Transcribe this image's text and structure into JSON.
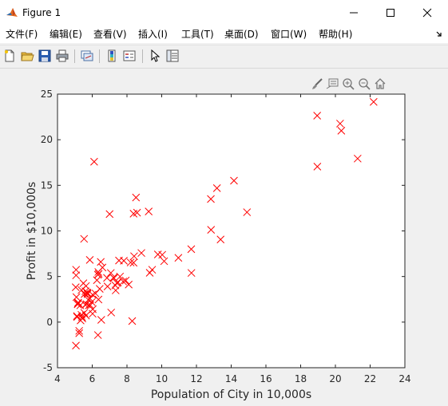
{
  "window": {
    "title": "Figure 1",
    "icon": "matlab-logo-icon"
  },
  "menu": {
    "items": [
      {
        "label": "文件(F)"
      },
      {
        "label": "编辑(E)"
      },
      {
        "label": "查看(V)"
      },
      {
        "label": "插入(I)"
      },
      {
        "label": "工具(T)"
      },
      {
        "label": "桌面(D)"
      },
      {
        "label": "窗口(W)"
      },
      {
        "label": "帮助(H)"
      }
    ],
    "overflow_icon": "chevron-corner-icon"
  },
  "toolbar": {
    "buttons": [
      "new-figure-icon",
      "open-file-icon",
      "save-icon",
      "print-icon",
      "link-plot-icon",
      "insert-colorbar-icon",
      "insert-legend-icon",
      "pointer-icon",
      "property-editor-icon"
    ]
  },
  "axes_toolbar": {
    "buttons": [
      "brush-icon",
      "data-tips-icon",
      "zoom-in-icon",
      "zoom-out-icon",
      "home-icon"
    ]
  },
  "colors": {
    "marker": "#ff0000",
    "axes_bg": "#ffffff",
    "figure_bg": "#f0f0f0"
  },
  "chart_data": {
    "type": "scatter",
    "xlabel": "Population of City in 10,000s",
    "ylabel": "Profit in $10,000s",
    "xlim": [
      4,
      24
    ],
    "ylim": [
      -5,
      25
    ],
    "xticks": [
      4,
      6,
      8,
      10,
      12,
      14,
      16,
      18,
      20,
      22,
      24
    ],
    "yticks": [
      -5,
      0,
      5,
      10,
      15,
      20,
      25
    ],
    "marker": "x",
    "grid": false,
    "points": [
      {
        "x": 6.11,
        "y": 17.59
      },
      {
        "x": 5.53,
        "y": 9.13
      },
      {
        "x": 8.52,
        "y": 13.66
      },
      {
        "x": 7.0,
        "y": 11.85
      },
      {
        "x": 5.86,
        "y": 6.82
      },
      {
        "x": 8.38,
        "y": 11.89
      },
      {
        "x": 7.48,
        "y": 4.35
      },
      {
        "x": 8.58,
        "y": 12.0
      },
      {
        "x": 6.49,
        "y": 6.6
      },
      {
        "x": 5.05,
        "y": 3.82
      },
      {
        "x": 5.71,
        "y": 3.25
      },
      {
        "x": 14.16,
        "y": 15.51
      },
      {
        "x": 5.73,
        "y": 3.16
      },
      {
        "x": 8.41,
        "y": 7.23
      },
      {
        "x": 5.64,
        "y": 0.72
      },
      {
        "x": 5.38,
        "y": 3.51
      },
      {
        "x": 6.37,
        "y": 5.3
      },
      {
        "x": 5.13,
        "y": 0.56
      },
      {
        "x": 6.43,
        "y": 3.65
      },
      {
        "x": 7.07,
        "y": 5.39
      },
      {
        "x": 6.19,
        "y": 3.14
      },
      {
        "x": 20.27,
        "y": 21.77
      },
      {
        "x": 5.49,
        "y": 4.26
      },
      {
        "x": 6.33,
        "y": 5.19
      },
      {
        "x": 5.56,
        "y": 3.08
      },
      {
        "x": 18.95,
        "y": 22.64
      },
      {
        "x": 12.83,
        "y": 13.5
      },
      {
        "x": 10.96,
        "y": 7.05
      },
      {
        "x": 13.18,
        "y": 14.69
      },
      {
        "x": 22.2,
        "y": 24.15
      },
      {
        "x": 5.25,
        "y": -1.22
      },
      {
        "x": 6.59,
        "y": 5.99
      },
      {
        "x": 9.25,
        "y": 12.13
      },
      {
        "x": 5.89,
        "y": 1.85
      },
      {
        "x": 8.21,
        "y": 6.54
      },
      {
        "x": 7.93,
        "y": 4.56
      },
      {
        "x": 8.1,
        "y": 4.12
      },
      {
        "x": 5.61,
        "y": 3.39
      },
      {
        "x": 12.84,
        "y": 10.12
      },
      {
        "x": 6.35,
        "y": 5.5
      },
      {
        "x": 5.41,
        "y": 0.56
      },
      {
        "x": 6.88,
        "y": 3.91
      },
      {
        "x": 11.71,
        "y": 5.39
      },
      {
        "x": 5.77,
        "y": 2.44
      },
      {
        "x": 7.82,
        "y": 6.73
      },
      {
        "x": 7.09,
        "y": 1.05
      },
      {
        "x": 5.07,
        "y": 5.13
      },
      {
        "x": 5.8,
        "y": 1.84
      },
      {
        "x": 11.7,
        "y": 8.0
      },
      {
        "x": 5.54,
        "y": 1.02
      },
      {
        "x": 7.54,
        "y": 6.75
      },
      {
        "x": 5.31,
        "y": 1.84
      },
      {
        "x": 7.42,
        "y": 4.29
      },
      {
        "x": 7.6,
        "y": 5.0
      },
      {
        "x": 6.03,
        "y": 1.42
      },
      {
        "x": 6.33,
        "y": -1.42
      },
      {
        "x": 6.36,
        "y": 2.48
      },
      {
        "x": 6.27,
        "y": 4.6
      },
      {
        "x": 5.64,
        "y": 3.96
      },
      {
        "x": 9.31,
        "y": 5.41
      },
      {
        "x": 9.45,
        "y": 5.74
      },
      {
        "x": 8.83,
        "y": 7.58
      },
      {
        "x": 5.18,
        "y": 2.06
      },
      {
        "x": 21.28,
        "y": 17.93
      },
      {
        "x": 14.91,
        "y": 12.05
      },
      {
        "x": 18.96,
        "y": 17.05
      },
      {
        "x": 7.22,
        "y": 4.89
      },
      {
        "x": 5.07,
        "y": 5.74
      },
      {
        "x": 5.73,
        "y": 3.07
      },
      {
        "x": 7.78,
        "y": 4.45
      },
      {
        "x": 5.67,
        "y": 1.98
      },
      {
        "x": 9.78,
        "y": 7.42
      },
      {
        "x": 5.16,
        "y": 1.95
      },
      {
        "x": 20.34,
        "y": 20.99
      },
      {
        "x": 10.14,
        "y": 6.68
      },
      {
        "x": 7.33,
        "y": 4.03
      },
      {
        "x": 6.02,
        "y": 3.0
      },
      {
        "x": 7.35,
        "y": 3.48
      },
      {
        "x": 8.3,
        "y": 0.12
      },
      {
        "x": 5.38,
        "y": 0.8
      },
      {
        "x": 13.39,
        "y": 9.06
      },
      {
        "x": 8.38,
        "y": 6.51
      },
      {
        "x": 5.19,
        "y": 2.14
      },
      {
        "x": 6.85,
        "y": 4.85
      },
      {
        "x": 5.87,
        "y": 2.59
      },
      {
        "x": 7.25,
        "y": 4.82
      },
      {
        "x": 10.03,
        "y": 7.38
      },
      {
        "x": 5.09,
        "y": 2.74
      },
      {
        "x": 5.12,
        "y": 0.66
      },
      {
        "x": 5.25,
        "y": -0.96
      },
      {
        "x": 5.06,
        "y": -2.57
      },
      {
        "x": 5.43,
        "y": 0.4
      },
      {
        "x": 5.6,
        "y": 1.9
      },
      {
        "x": 5.97,
        "y": 2.2
      },
      {
        "x": 6.52,
        "y": 0.25
      },
      {
        "x": 6.02,
        "y": 0.92
      },
      {
        "x": 5.33,
        "y": 0.18
      }
    ]
  }
}
